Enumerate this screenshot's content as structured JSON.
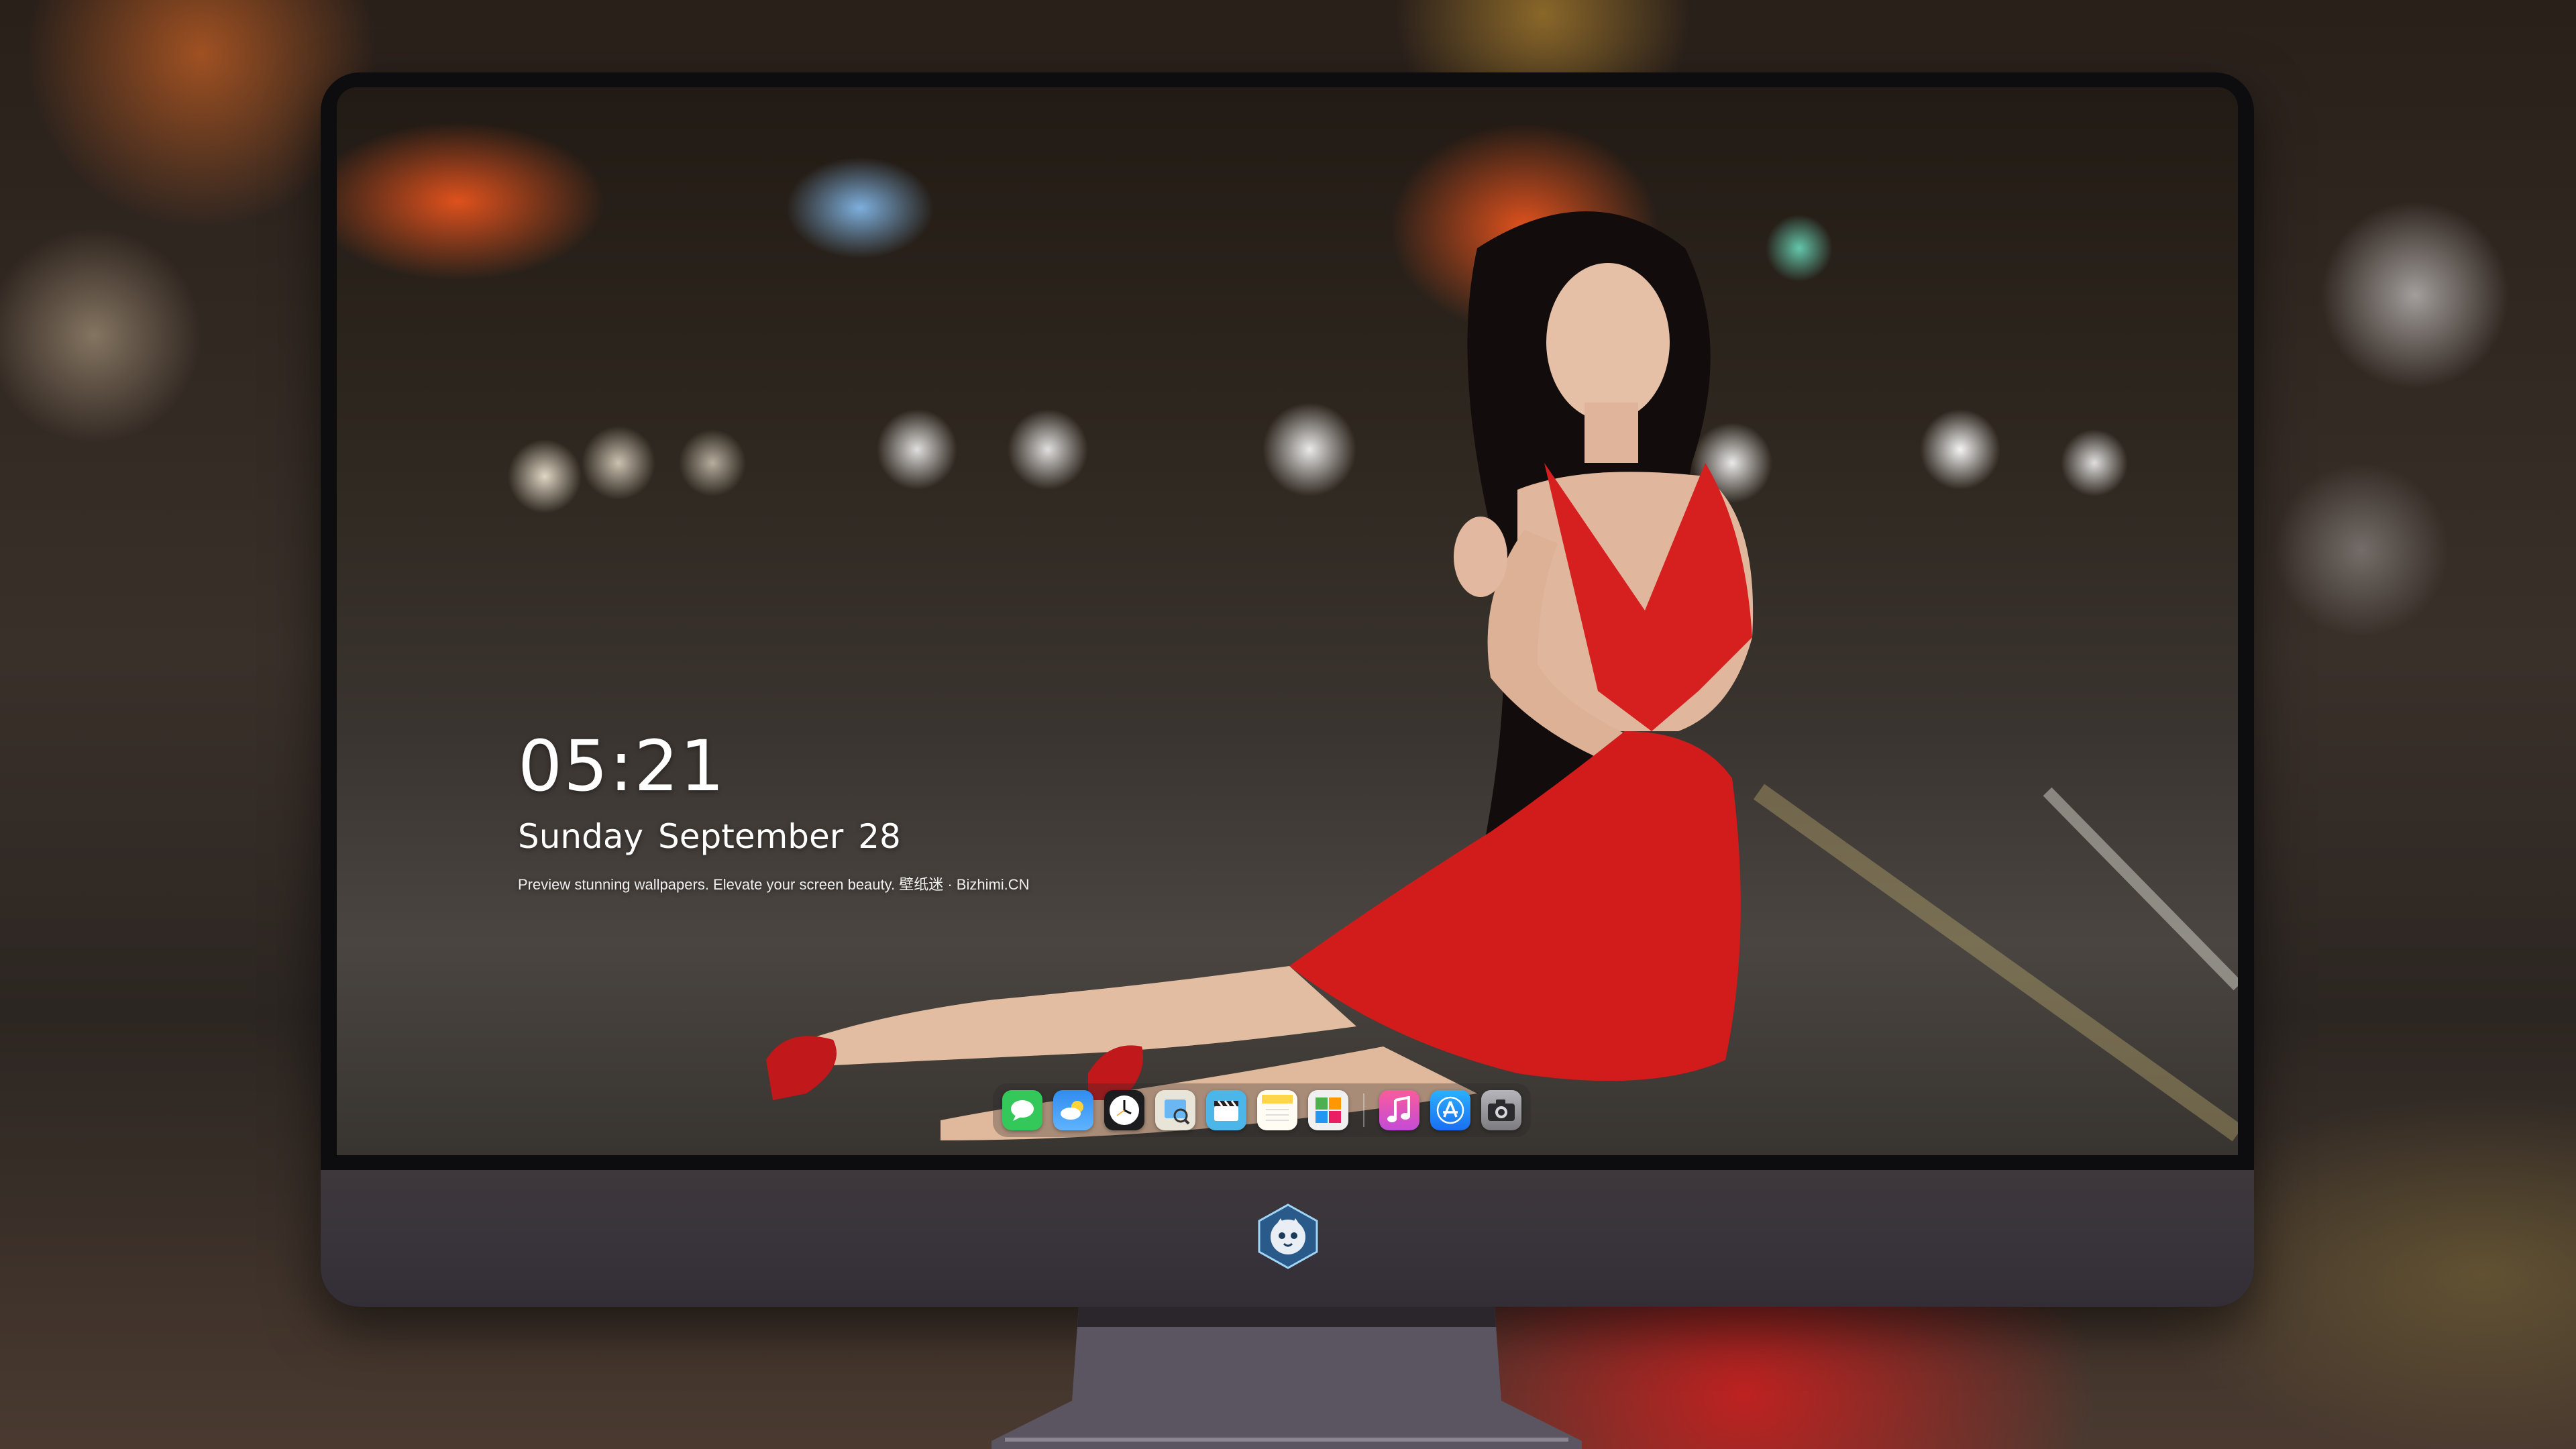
{
  "lockscreen": {
    "time": "05:21",
    "date": "Sunday September  28",
    "caption": "Preview stunning wallpapers. Elevate your screen beauty. 壁纸迷 · Bizhimi.CN"
  },
  "dock": {
    "apps": [
      {
        "icon": "messages-icon",
        "color": "#34c759"
      },
      {
        "icon": "weather-icon",
        "color": "#2f8cf0"
      },
      {
        "icon": "clock-icon",
        "color": "#1c1c1e"
      },
      {
        "icon": "preview-icon",
        "color": "#e9e4d8"
      },
      {
        "icon": "clips-icon",
        "color": "#4db6e8"
      },
      {
        "icon": "notes-icon",
        "color": "#ffd54a"
      },
      {
        "icon": "photo-booth-icon",
        "color": "#f0f0f0"
      },
      {
        "icon": "music-icon",
        "color": "#e84fb7"
      },
      {
        "icon": "app-store-icon",
        "color": "#1e8cf6"
      },
      {
        "icon": "camera-icon",
        "color": "#8e8e93"
      }
    ]
  },
  "colors": {
    "dress": "#d61f1f",
    "monitor_chin": "#3a343b",
    "monitor_bezel": "#0d0d10"
  }
}
